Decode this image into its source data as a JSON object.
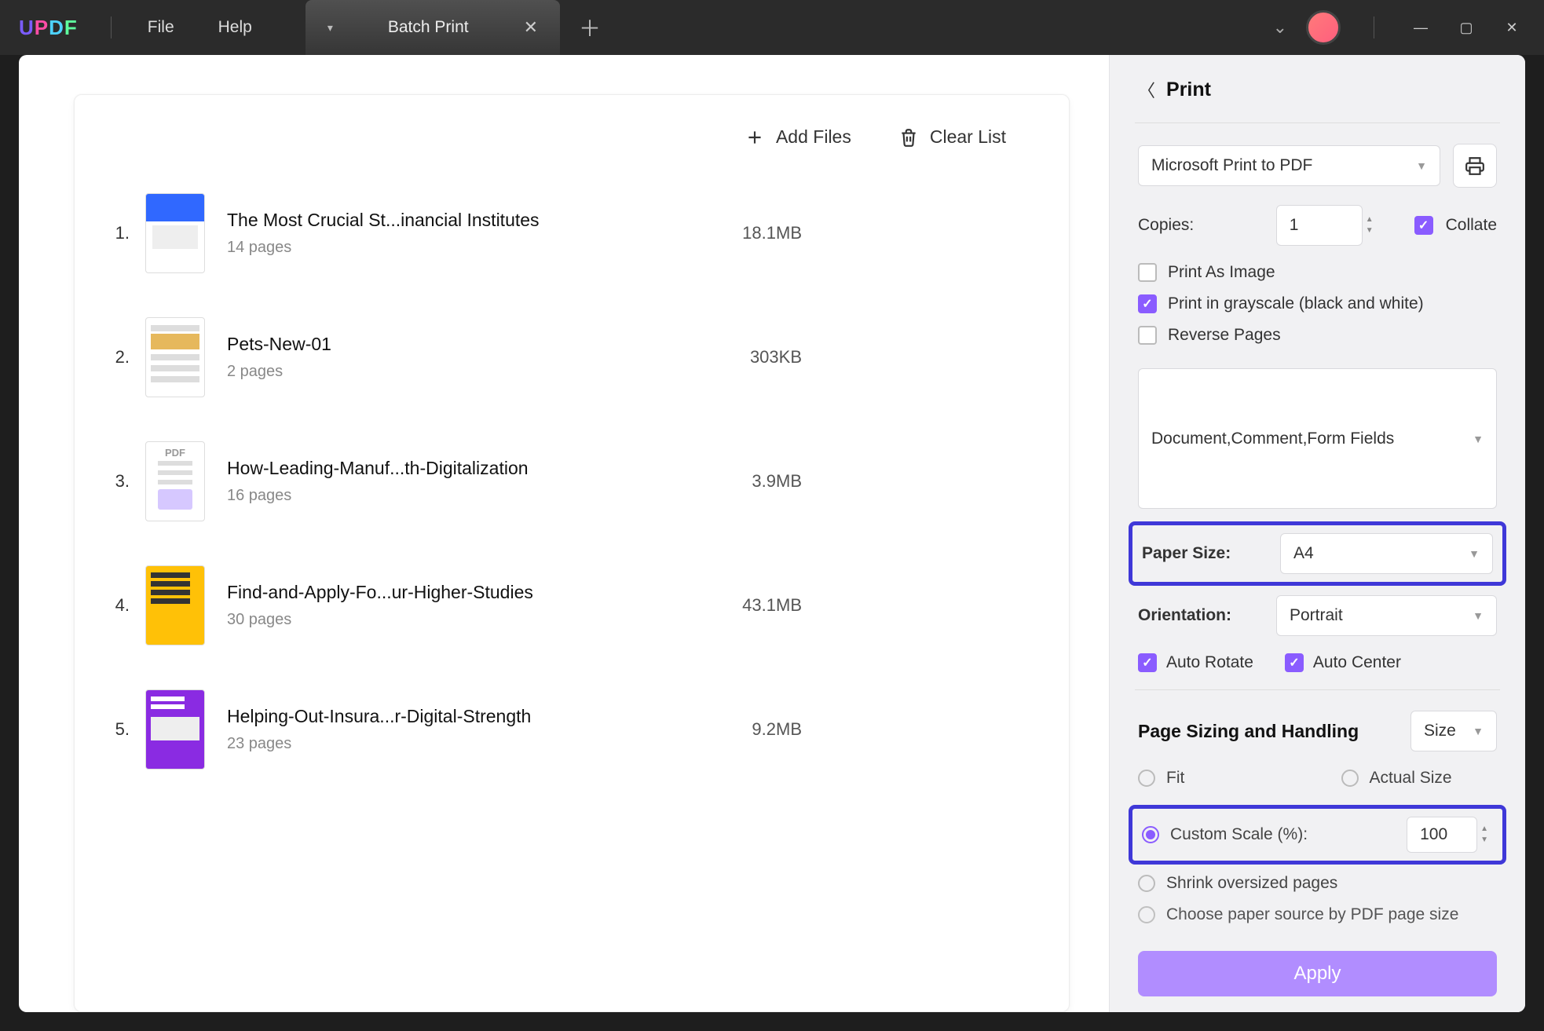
{
  "titlebar": {
    "menu_file": "File",
    "menu_help": "Help",
    "tab_label": "Batch Print"
  },
  "toolbar": {
    "add_files": "Add Files",
    "clear_list": "Clear List"
  },
  "files": [
    {
      "idx": "1.",
      "title": "The Most Crucial St...inancial Institutes",
      "pages": "14 pages",
      "size": "18.1MB",
      "thumb": "blue"
    },
    {
      "idx": "2.",
      "title": "Pets-New-01",
      "pages": "2 pages",
      "size": "303KB",
      "thumb": "doc"
    },
    {
      "idx": "3.",
      "title": "How-Leading-Manuf...th-Digitalization",
      "pages": "16 pages",
      "size": "3.9MB",
      "thumb": "pdf"
    },
    {
      "idx": "4.",
      "title": "Find-and-Apply-Fo...ur-Higher-Studies",
      "pages": "30 pages",
      "size": "43.1MB",
      "thumb": "yellow"
    },
    {
      "idx": "5.",
      "title": "Helping-Out-Insura...r-Digital-Strength",
      "pages": "23 pages",
      "size": "9.2MB",
      "thumb": "purple"
    }
  ],
  "print": {
    "title": "Print",
    "printer": "Microsoft Print to PDF",
    "copies_label": "Copies:",
    "copies_value": "1",
    "collate": "Collate",
    "print_as_image": "Print As Image",
    "grayscale": "Print in grayscale (black and white)",
    "reverse": "Reverse Pages",
    "content_select": "Document,Comment,Form Fields",
    "paper_size_label": "Paper Size:",
    "paper_size_value": "A4",
    "orientation_label": "Orientation:",
    "orientation_value": "Portrait",
    "auto_rotate": "Auto Rotate",
    "auto_center": "Auto Center",
    "sizing_title": "Page Sizing and Handling",
    "size_btn": "Size",
    "fit": "Fit",
    "actual": "Actual Size",
    "custom_scale": "Custom Scale (%):",
    "custom_scale_value": "100",
    "shrink": "Shrink oversized pages",
    "choose_source": "Choose paper source by PDF page size",
    "apply": "Apply"
  }
}
